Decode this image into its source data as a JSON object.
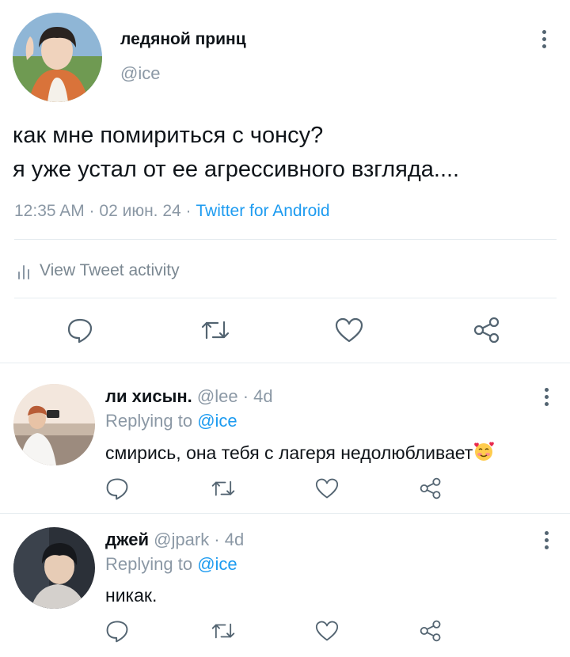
{
  "main_tweet": {
    "author_name": "ледяной принц",
    "handle": "@ice",
    "text_line1": "как мне помириться с чонсу?",
    "text_line2": "я уже устал от ее агрессивного взгляда....",
    "meta_time_date": "12:35 AM · 02 июн. 24 · ",
    "meta_source": "Twitter for Android",
    "activity_label": "View Tweet activity"
  },
  "replies": [
    {
      "name": "ли хисын.",
      "handle_time": "@lee · 4d",
      "replying_prefix": "Replying to ",
      "replying_handle": "@ice",
      "text": "смирись, она тебя с лагеря недолюбливает"
    },
    {
      "name": "джей",
      "handle_time": "@jpark · 4d",
      "replying_prefix": "Replying to ",
      "replying_handle": "@ice",
      "text": "никак."
    }
  ],
  "icons": [
    "reply-icon",
    "retweet-icon",
    "like-icon",
    "share-icon",
    "more-icon",
    "bar-chart-icon"
  ],
  "colors": {
    "link": "#1d9bf0",
    "muted": "#8b98a5",
    "icon": "#536471",
    "divider": "#e6ecf0",
    "text": "#0f1419"
  }
}
